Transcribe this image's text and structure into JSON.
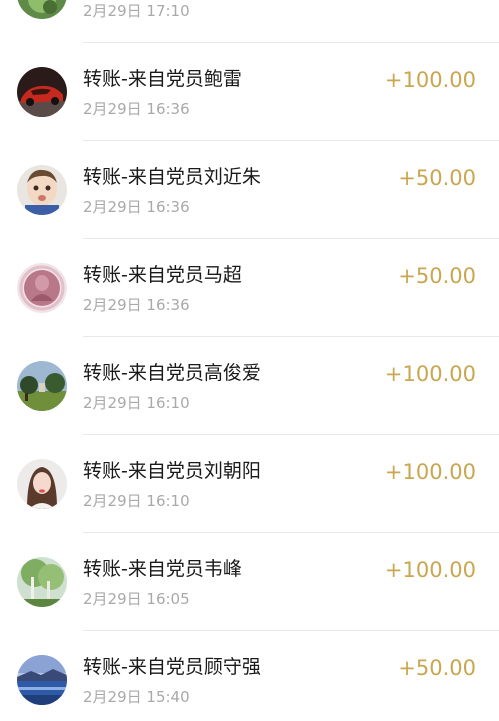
{
  "transactions": [
    {
      "title": "",
      "time": "2月29日 17:10",
      "amount": "",
      "avatar": "green-leaf-icon"
    },
    {
      "title": "转账-来自党员鲍雷",
      "time": "2月29日 16:36",
      "amount": "+100.00",
      "avatar": "red-car-icon"
    },
    {
      "title": "转账-来自党员刘近朱",
      "time": "2月29日 16:36",
      "amount": "+50.00",
      "avatar": "child-face-icon"
    },
    {
      "title": "转账-来自党员马超",
      "time": "2月29日 16:36",
      "amount": "+50.00",
      "avatar": "buddha-icon"
    },
    {
      "title": "转账-来自党员高俊爱",
      "time": "2月29日 16:10",
      "amount": "+100.00",
      "avatar": "landscape-icon"
    },
    {
      "title": "转账-来自党员刘朝阳",
      "time": "2月29日 16:10",
      "amount": "+100.00",
      "avatar": "woman-portrait-icon"
    },
    {
      "title": "转账-来自党员韦峰",
      "time": "2月29日 16:05",
      "amount": "+100.00",
      "avatar": "birch-trees-icon"
    },
    {
      "title": "转账-来自党员顾守强",
      "time": "2月29日 15:40",
      "amount": "+50.00",
      "avatar": "lake-sunset-icon"
    }
  ],
  "colors": {
    "amount": "#c9a650",
    "title": "#1a1a1a",
    "time": "#a9a9a9",
    "divider": "#e8e8e8"
  }
}
